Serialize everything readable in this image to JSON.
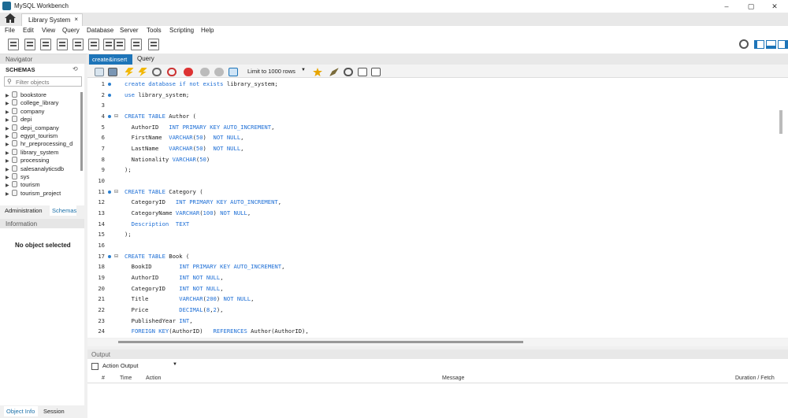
{
  "window": {
    "title": "MySQL Workbench",
    "controls": [
      "–",
      "▢",
      "✕"
    ]
  },
  "connection_tab": {
    "label": "Library System",
    "close": "×"
  },
  "menu": [
    "File",
    "Edit",
    "View",
    "Query",
    "Database",
    "Server",
    "Tools",
    "Scripting",
    "Help"
  ],
  "navigator": {
    "header": "Navigator",
    "schemas_label": "SCHEMAS",
    "filter_placeholder": "Filter objects",
    "schemas": [
      "bookstore",
      "college_library",
      "company",
      "depi",
      "depi_company",
      "egypt_tourism",
      "hr_preprocessing_d",
      "library_system",
      "processing",
      "salesanalyticsdb",
      "sys",
      "tourism",
      "tourism_project"
    ]
  },
  "left_tabs": {
    "admin": "Administration",
    "schemas": "Schemas"
  },
  "information": {
    "header": "Information",
    "empty": "No object selected",
    "tab_object": "Object Info",
    "tab_session": "Session"
  },
  "query_tabs": [
    "create&insert",
    "Query"
  ],
  "editor_toolbar": {
    "limit": "Limit to 1000 rows"
  },
  "editor": {
    "lines": [
      {
        "n": "1",
        "dot": true,
        "fold": false,
        "t": [
          [
            "kw",
            "create database if not exists"
          ],
          [
            "",
            "library_system;"
          ]
        ]
      },
      {
        "n": "2",
        "dot": true,
        "fold": false,
        "t": [
          [
            "kw",
            "use"
          ],
          [
            "",
            "library_system;"
          ]
        ]
      },
      {
        "n": "3",
        "dot": false,
        "fold": false,
        "t": []
      },
      {
        "n": "4",
        "dot": true,
        "fold": true,
        "t": [
          [
            "kw",
            "CREATE TABLE"
          ],
          [
            "",
            "Author ("
          ]
        ]
      },
      {
        "n": "5",
        "dot": false,
        "fold": false,
        "t": [
          [
            "",
            "  AuthorID   "
          ],
          [
            "kw",
            "INT PRIMARY KEY AUTO_INCREMENT"
          ],
          [
            "",
            ","
          ]
        ]
      },
      {
        "n": "6",
        "dot": false,
        "fold": false,
        "t": [
          [
            "",
            "  FirstName  "
          ],
          [
            "kw",
            "VARCHAR"
          ],
          [
            "",
            "("
          ],
          [
            "kw",
            "50"
          ],
          [
            "",
            ")  "
          ],
          [
            "kw",
            "NOT NULL"
          ],
          [
            "",
            ","
          ]
        ]
      },
      {
        "n": "7",
        "dot": false,
        "fold": false,
        "t": [
          [
            "",
            "  LastName   "
          ],
          [
            "kw",
            "VARCHAR"
          ],
          [
            "",
            "("
          ],
          [
            "kw",
            "50"
          ],
          [
            "",
            ")  "
          ],
          [
            "kw",
            "NOT NULL"
          ],
          [
            "",
            ","
          ]
        ]
      },
      {
        "n": "8",
        "dot": false,
        "fold": false,
        "t": [
          [
            "",
            "  Nationality "
          ],
          [
            "kw",
            "VARCHAR"
          ],
          [
            "",
            "("
          ],
          [
            "kw",
            "50"
          ],
          [
            "",
            ")"
          ]
        ]
      },
      {
        "n": "9",
        "dot": false,
        "fold": false,
        "t": [
          [
            "",
            ");"
          ]
        ]
      },
      {
        "n": "10",
        "dot": false,
        "fold": false,
        "t": []
      },
      {
        "n": "11",
        "dot": true,
        "fold": true,
        "t": [
          [
            "kw",
            "CREATE TABLE"
          ],
          [
            "",
            "Category ("
          ]
        ]
      },
      {
        "n": "12",
        "dot": false,
        "fold": false,
        "t": [
          [
            "",
            "  CategoryID   "
          ],
          [
            "kw",
            "INT PRIMARY KEY AUTO_INCREMENT"
          ],
          [
            "",
            ","
          ]
        ]
      },
      {
        "n": "13",
        "dot": false,
        "fold": false,
        "t": [
          [
            "",
            "  CategoryName "
          ],
          [
            "kw",
            "VARCHAR"
          ],
          [
            "",
            "("
          ],
          [
            "kw",
            "100"
          ],
          [
            "",
            ") "
          ],
          [
            "kw",
            "NOT NULL"
          ],
          [
            "",
            ","
          ]
        ]
      },
      {
        "n": "14",
        "dot": false,
        "fold": false,
        "t": [
          [
            "",
            "  "
          ],
          [
            "kw",
            "Description  TEXT"
          ]
        ]
      },
      {
        "n": "15",
        "dot": false,
        "fold": false,
        "t": [
          [
            "",
            ");"
          ]
        ]
      },
      {
        "n": "16",
        "dot": false,
        "fold": false,
        "t": []
      },
      {
        "n": "17",
        "dot": true,
        "fold": true,
        "t": [
          [
            "kw",
            "CREATE TABLE"
          ],
          [
            "",
            "Book ("
          ]
        ]
      },
      {
        "n": "18",
        "dot": false,
        "fold": false,
        "t": [
          [
            "",
            "  BookID        "
          ],
          [
            "kw",
            "INT PRIMARY KEY AUTO_INCREMENT"
          ],
          [
            "",
            ","
          ]
        ]
      },
      {
        "n": "19",
        "dot": false,
        "fold": false,
        "t": [
          [
            "",
            "  AuthorID      "
          ],
          [
            "kw",
            "INT NOT NULL"
          ],
          [
            "",
            ","
          ]
        ]
      },
      {
        "n": "20",
        "dot": false,
        "fold": false,
        "t": [
          [
            "",
            "  CategoryID    "
          ],
          [
            "kw",
            "INT NOT NULL"
          ],
          [
            "",
            ","
          ]
        ]
      },
      {
        "n": "21",
        "dot": false,
        "fold": false,
        "t": [
          [
            "",
            "  Title         "
          ],
          [
            "kw",
            "VARCHAR"
          ],
          [
            "",
            "("
          ],
          [
            "kw",
            "200"
          ],
          [
            "",
            ") "
          ],
          [
            "kw",
            "NOT NULL"
          ],
          [
            "",
            ","
          ]
        ]
      },
      {
        "n": "22",
        "dot": false,
        "fold": false,
        "t": [
          [
            "",
            "  Price         "
          ],
          [
            "kw",
            "DECIMAL"
          ],
          [
            "",
            "("
          ],
          [
            "kw",
            "8"
          ],
          [
            "",
            ","
          ],
          [
            "kw",
            "2"
          ],
          [
            "",
            "),"
          ]
        ]
      },
      {
        "n": "23",
        "dot": false,
        "fold": false,
        "t": [
          [
            "",
            "  PublishedYear "
          ],
          [
            "kw",
            "INT"
          ],
          [
            "",
            ","
          ]
        ]
      },
      {
        "n": "24",
        "dot": false,
        "fold": false,
        "t": [
          [
            "",
            "  "
          ],
          [
            "kw",
            "FOREIGN KEY"
          ],
          [
            "",
            "(AuthorID)   "
          ],
          [
            "kw",
            "REFERENCES"
          ],
          [
            "",
            "Author(AuthorID),"
          ]
        ]
      }
    ]
  },
  "output": {
    "header": "Output",
    "select": "Action Output",
    "columns": [
      "#",
      "Time",
      "Action",
      "Message",
      "Duration / Fetch"
    ]
  },
  "colors": {
    "accent": "#1d74b8",
    "keyword": "#1e6fd6"
  }
}
